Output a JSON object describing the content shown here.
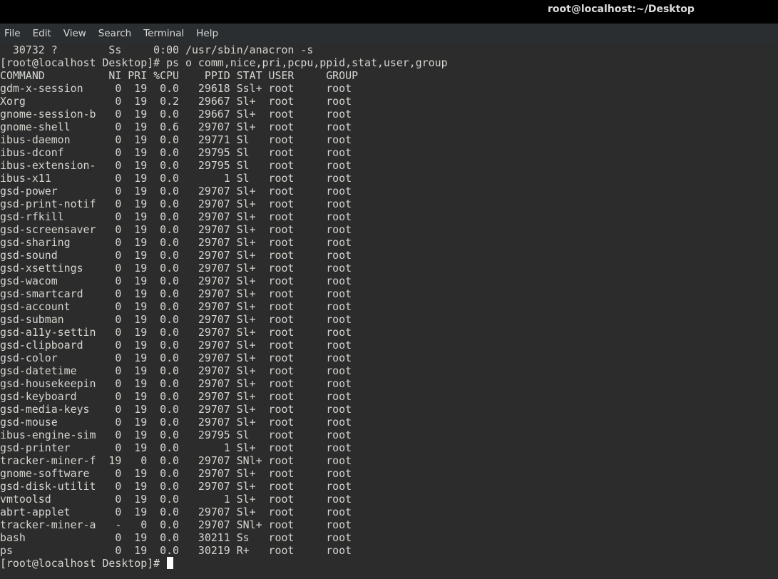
{
  "window": {
    "title": "root@localhost:~/Desktop"
  },
  "menu": {
    "items": [
      "File",
      "Edit",
      "View",
      "Search",
      "Terminal",
      "Help"
    ]
  },
  "terminal": {
    "lines": [
      "  30732 ?        Ss     0:00 /usr/sbin/anacron -s",
      "[root@localhost Desktop]# ps o comm,nice,pri,pcpu,ppid,stat,user,group",
      "COMMAND          NI PRI %CPU    PPID STAT USER     GROUP",
      "gdm-x-session     0  19  0.0   29618 Ssl+ root     root",
      "Xorg              0  19  0.2   29667 Sl+  root     root",
      "gnome-session-b   0  19  0.0   29667 Sl+  root     root",
      "gnome-shell       0  19  0.6   29707 Sl+  root     root",
      "ibus-daemon       0  19  0.0   29771 Sl   root     root",
      "ibus-dconf        0  19  0.0   29795 Sl   root     root",
      "ibus-extension-   0  19  0.0   29795 Sl   root     root",
      "ibus-x11          0  19  0.0       1 Sl   root     root",
      "gsd-power         0  19  0.0   29707 Sl+  root     root",
      "gsd-print-notif   0  19  0.0   29707 Sl+  root     root",
      "gsd-rfkill        0  19  0.0   29707 Sl+  root     root",
      "gsd-screensaver   0  19  0.0   29707 Sl+  root     root",
      "gsd-sharing       0  19  0.0   29707 Sl+  root     root",
      "gsd-sound         0  19  0.0   29707 Sl+  root     root",
      "gsd-xsettings     0  19  0.0   29707 Sl+  root     root",
      "gsd-wacom         0  19  0.0   29707 Sl+  root     root",
      "gsd-smartcard     0  19  0.0   29707 Sl+  root     root",
      "gsd-account       0  19  0.0   29707 Sl+  root     root",
      "gsd-subman        0  19  0.0   29707 Sl+  root     root",
      "gsd-a11y-settin   0  19  0.0   29707 Sl+  root     root",
      "gsd-clipboard     0  19  0.0   29707 Sl+  root     root",
      "gsd-color         0  19  0.0   29707 Sl+  root     root",
      "gsd-datetime      0  19  0.0   29707 Sl+  root     root",
      "gsd-housekeepin   0  19  0.0   29707 Sl+  root     root",
      "gsd-keyboard      0  19  0.0   29707 Sl+  root     root",
      "gsd-media-keys    0  19  0.0   29707 Sl+  root     root",
      "gsd-mouse         0  19  0.0   29707 Sl+  root     root",
      "ibus-engine-sim   0  19  0.0   29795 Sl   root     root",
      "gsd-printer       0  19  0.0       1 Sl+  root     root",
      "tracker-miner-f  19   0  0.0   29707 SNl+ root     root",
      "gnome-software    0  19  0.0   29707 Sl+  root     root",
      "gsd-disk-utilit   0  19  0.0   29707 Sl+  root     root",
      "vmtoolsd          0  19  0.0       1 Sl+  root     root",
      "abrt-applet       0  19  0.0   29707 Sl+  root     root",
      "tracker-miner-a   -   0  0.0   29707 SNl+ root     root",
      "bash              0  19  0.0   30211 Ss   root     root",
      "ps                0  19  0.0   30219 R+   root     root"
    ],
    "prompt": "[root@localhost Desktop]# "
  }
}
